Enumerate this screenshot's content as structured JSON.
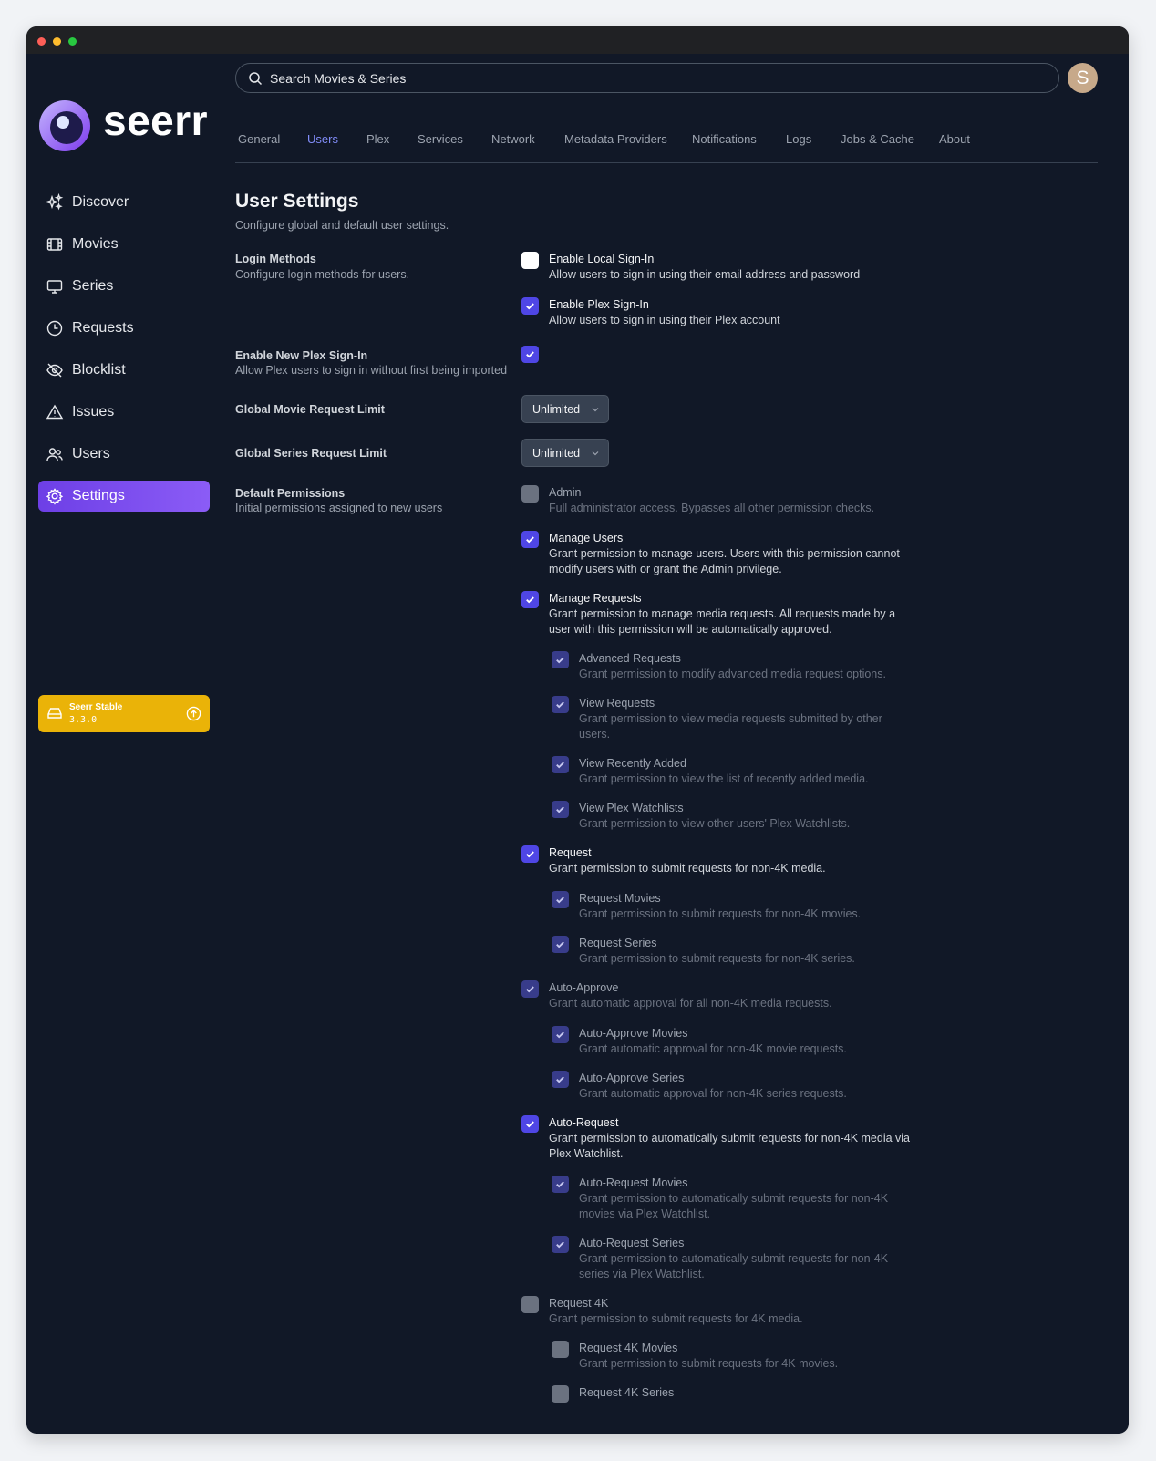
{
  "app": {
    "logo_text": "seerr",
    "version_name": "Seerr Stable",
    "version_number": "3.3.0",
    "avatar_letter": "S"
  },
  "sidebar": {
    "items": [
      {
        "label": "Discover",
        "icon": "sparkles-icon"
      },
      {
        "label": "Movies",
        "icon": "film-icon"
      },
      {
        "label": "Series",
        "icon": "tv-icon"
      },
      {
        "label": "Requests",
        "icon": "clock-icon"
      },
      {
        "label": "Blocklist",
        "icon": "eye-slash-icon"
      },
      {
        "label": "Issues",
        "icon": "warning-icon"
      },
      {
        "label": "Users",
        "icon": "users-icon"
      },
      {
        "label": "Settings",
        "icon": "gear-icon",
        "active": true
      }
    ]
  },
  "search": {
    "placeholder": "Search Movies & Series"
  },
  "tabs": [
    {
      "label": "General"
    },
    {
      "label": "Users",
      "active": true
    },
    {
      "label": "Plex"
    },
    {
      "label": "Services"
    },
    {
      "label": "Network"
    },
    {
      "label": "Metadata Providers"
    },
    {
      "label": "Notifications"
    },
    {
      "label": "Logs"
    },
    {
      "label": "Jobs & Cache"
    },
    {
      "label": "About"
    }
  ],
  "page": {
    "title": "User Settings",
    "subtitle": "Configure global and default user settings."
  },
  "settings": {
    "login_methods": {
      "label": "Login Methods",
      "desc": "Configure login methods for users."
    },
    "local_signin": {
      "title": "Enable Local Sign-In",
      "desc": "Allow users to sign in using their email address and password",
      "checked": false
    },
    "plex_signin": {
      "title": "Enable Plex Sign-In",
      "desc": "Allow users to sign in using their Plex account",
      "checked": true
    },
    "new_plex_signin": {
      "label": "Enable New Plex Sign-In",
      "desc": "Allow Plex users to sign in without first being imported",
      "checked": true
    },
    "movie_limit": {
      "label": "Global Movie Request Limit",
      "value": "Unlimited"
    },
    "series_limit": {
      "label": "Global Series Request Limit",
      "value": "Unlimited"
    },
    "default_permissions": {
      "label": "Default Permissions",
      "desc": "Initial permissions assigned to new users"
    }
  },
  "permissions": [
    {
      "title": "Admin",
      "desc": "Full administrator access. Bypasses all other permission checks.",
      "state": "off-gray",
      "dim": true
    },
    {
      "title": "Manage Users",
      "desc": "Grant permission to manage users. Users with this permission cannot modify users with or grant the Admin privilege.",
      "state": "on"
    },
    {
      "title": "Manage Requests",
      "desc": "Grant permission to manage media requests. All requests made by a user with this permission will be automatically approved.",
      "state": "on"
    },
    {
      "title": "Advanced Requests",
      "desc": "Grant permission to modify advanced media request options.",
      "state": "dim",
      "dim": true
    },
    {
      "title": "View Requests",
      "desc": "Grant permission to view media requests submitted by other users.",
      "state": "dim",
      "dim": true
    },
    {
      "title": "View Recently Added",
      "desc": "Grant permission to view the list of recently added media.",
      "state": "dim",
      "dim": true
    },
    {
      "title": "View Plex Watchlists",
      "desc": "Grant permission to view other users' Plex Watchlists.",
      "state": "dim",
      "dim": true
    },
    {
      "title": "Request",
      "desc": "Grant permission to submit requests for non-4K media.",
      "state": "on"
    },
    {
      "title": "Request Movies",
      "desc": "Grant permission to submit requests for non-4K movies.",
      "state": "dim",
      "dim": true
    },
    {
      "title": "Request Series",
      "desc": "Grant permission to submit requests for non-4K series.",
      "state": "dim",
      "dim": true
    },
    {
      "title": "Auto-Approve",
      "desc": "Grant automatic approval for all non-4K media requests.",
      "state": "dim",
      "dim": true
    },
    {
      "title": "Auto-Approve Movies",
      "desc": "Grant automatic approval for non-4K movie requests.",
      "state": "dim",
      "dim": true
    },
    {
      "title": "Auto-Approve Series",
      "desc": "Grant automatic approval for non-4K series requests.",
      "state": "dim",
      "dim": true
    },
    {
      "title": "Auto-Request",
      "desc": "Grant permission to automatically submit requests for non-4K media via Plex Watchlist.",
      "state": "on"
    },
    {
      "title": "Auto-Request Movies",
      "desc": "Grant permission to automatically submit requests for non-4K movies via Plex Watchlist.",
      "state": "dim",
      "dim": true
    },
    {
      "title": "Auto-Request Series",
      "desc": "Grant permission to automatically submit requests for non-4K series via Plex Watchlist.",
      "state": "dim",
      "dim": true
    },
    {
      "title": "Request 4K",
      "desc": "Grant permission to submit requests for 4K media.",
      "state": "off-gray",
      "dim": true
    },
    {
      "title": "Request 4K Movies",
      "desc": "Grant permission to submit requests for 4K movies.",
      "state": "off-gray",
      "dim": true
    },
    {
      "title": "Request 4K Series",
      "desc": "",
      "state": "off-gray",
      "dim": true
    }
  ],
  "colors": {
    "accent": "#4f46e5",
    "active_tab": "#818cf8",
    "settings_gradient_start": "#6d3fe6",
    "version_badge": "#eab308"
  }
}
